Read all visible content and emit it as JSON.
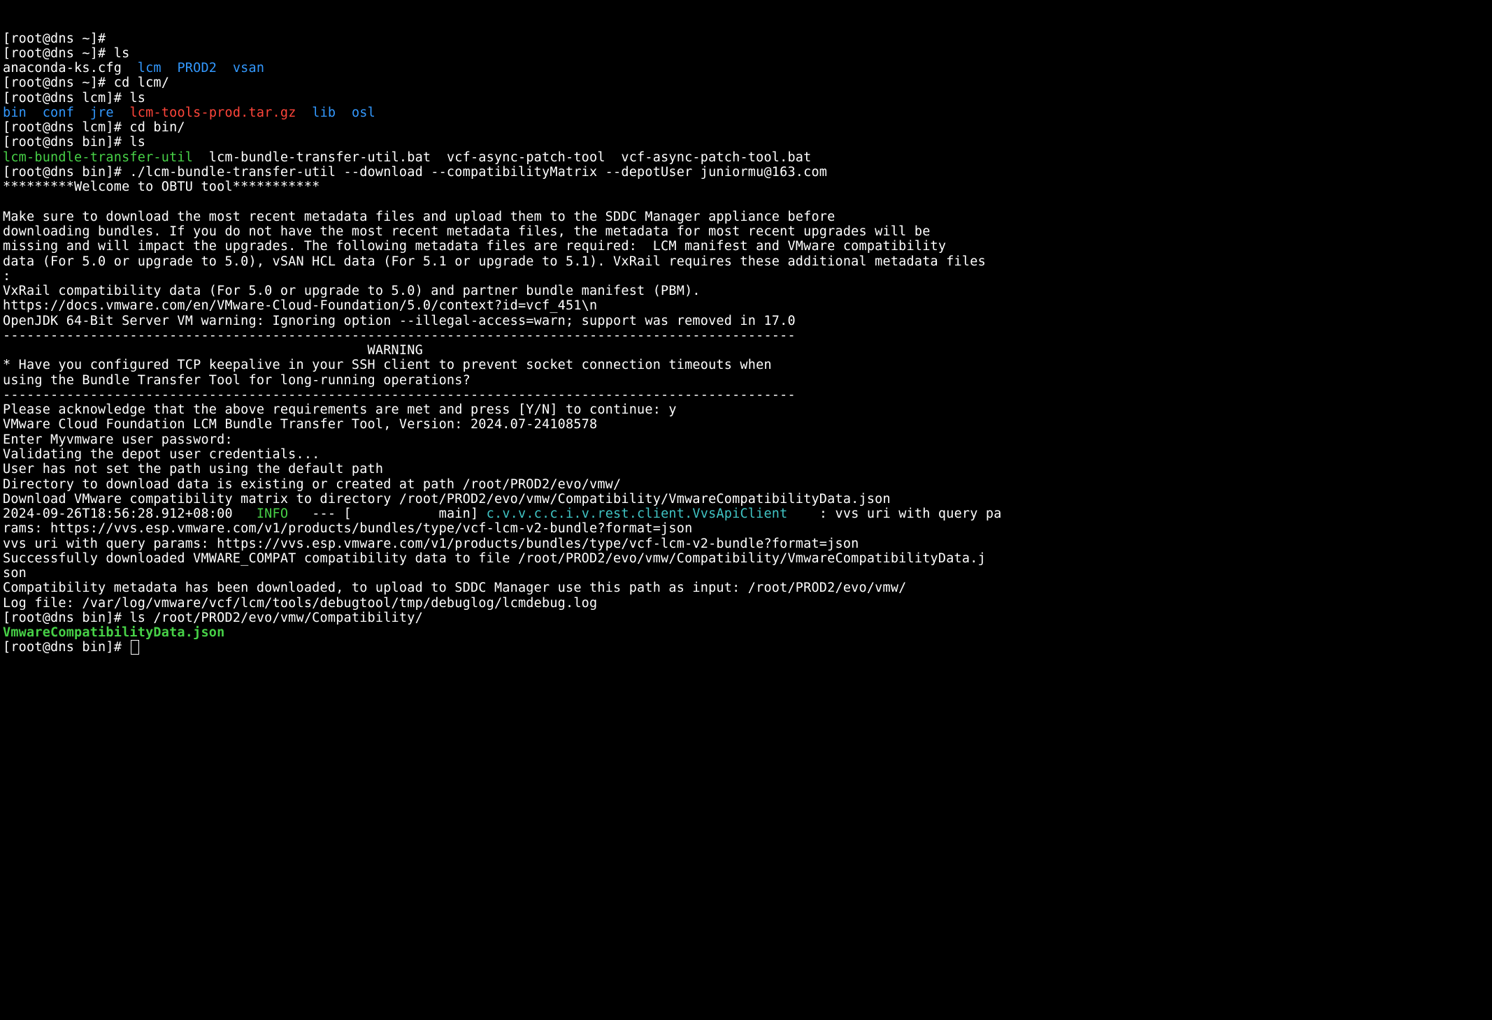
{
  "l01": "[root@dns ~]# ",
  "l02": "[root@dns ~]# ls",
  "l03a": "anaconda-ks.cfg  ",
  "l03b": "lcm",
  "l03c": "  ",
  "l03d": "PROD2",
  "l03e": "  ",
  "l03f": "vsan",
  "l04": "[root@dns ~]# cd lcm/",
  "l05": "[root@dns lcm]# ls",
  "l06a": "bin",
  "l06b": "  ",
  "l06c": "conf",
  "l06d": "  ",
  "l06e": "jre",
  "l06f": "  ",
  "l06g": "lcm-tools-prod.tar.gz",
  "l06h": "  ",
  "l06i": "lib",
  "l06j": "  ",
  "l06k": "osl",
  "l07": "[root@dns lcm]# cd bin/",
  "l08": "[root@dns bin]# ls",
  "l09a": "lcm-bundle-transfer-util",
  "l09b": "  lcm-bundle-transfer-util.bat  vcf-async-patch-tool  vcf-async-patch-tool.bat",
  "l10": "[root@dns bin]# ./lcm-bundle-transfer-util --download --compatibilityMatrix --depotUser juniormu@163.com",
  "l11": "*********Welcome to OBTU tool***********",
  "l12": "",
  "l13": "Make sure to download the most recent metadata files and upload them to the SDDC Manager appliance before",
  "l14": "downloading bundles. If you do not have the most recent metadata files, the metadata for most recent upgrades will be",
  "l15": "missing and will impact the upgrades. The following metadata files are required:  LCM manifest and VMware compatibility",
  "l16": "data (For 5.0 or upgrade to 5.0), vSAN HCL data (For 5.1 or upgrade to 5.1). VxRail requires these additional metadata files",
  "l17": ":",
  "l18": "VxRail compatibility data (For 5.0 or upgrade to 5.0) and partner bundle manifest (PBM).",
  "l19": "https://docs.vmware.com/en/VMware-Cloud-Foundation/5.0/context?id=vcf_451\\n",
  "l20": "OpenJDK 64-Bit Server VM warning: Ignoring option --illegal-access=warn; support was removed in 17.0",
  "l21": "----------------------------------------------------------------------------------------------------",
  "l22": "                                              WARNING",
  "l23": "* Have you configured TCP keepalive in your SSH client to prevent socket connection timeouts when",
  "l24": "using the Bundle Transfer Tool for long-running operations?",
  "l25": "----------------------------------------------------------------------------------------------------",
  "l26": "Please acknowledge that the above requirements are met and press [Y/N] to continue: y",
  "l27": "VMware Cloud Foundation LCM Bundle Transfer Tool, Version: 2024.07-24108578",
  "l28": "Enter Myvmware user password:",
  "l29": "Validating the depot user credentials...",
  "l30": "User has not set the path using the default path",
  "l31": "Directory to download data is existing or created at path /root/PROD2/evo/vmw/",
  "l32": "Download VMware compatibility matrix to directory /root/PROD2/evo/vmw/Compatibility/VmwareCompatibilityData.json",
  "l33a": "2024-09-26T18:56:28.912+08:00   ",
  "l33b": "INFO",
  "l33c": "   --- [           main] ",
  "l33d": "c.v.v.c.c.i.v.rest.client.VvsApiClient",
  "l33e": "    : vvs uri with query pa",
  "l34": "rams: https://vvs.esp.vmware.com/v1/products/bundles/type/vcf-lcm-v2-bundle?format=json",
  "l35": "vvs uri with query params: https://vvs.esp.vmware.com/v1/products/bundles/type/vcf-lcm-v2-bundle?format=json",
  "l36": "Successfully downloaded VMWARE_COMPAT compatibility data to file /root/PROD2/evo/vmw/Compatibility/VmwareCompatibilityData.j",
  "l37": "son",
  "l38": "Compatibility metadata has been downloaded, to upload to SDDC Manager use this path as input: /root/PROD2/evo/vmw/",
  "l39": "Log file: /var/log/vmware/vcf/lcm/tools/debugtool/tmp/debuglog/lcmdebug.log",
  "l40": "[root@dns bin]# ls /root/PROD2/evo/vmw/Compatibility/",
  "l41": "VmwareCompatibilityData.json",
  "l42": "[root@dns bin]# "
}
